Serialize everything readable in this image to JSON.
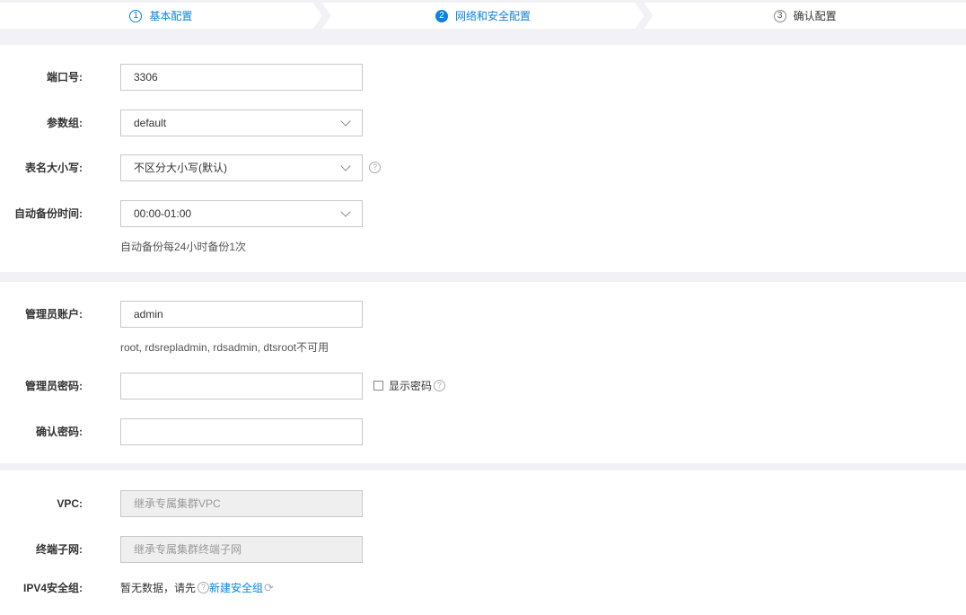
{
  "steps": [
    {
      "num": "1",
      "label": "基本配置"
    },
    {
      "num": "2",
      "label": "网络和安全配置"
    },
    {
      "num": "3",
      "label": "确认配置"
    }
  ],
  "db": {
    "port": {
      "label": "端口号:",
      "value": "3306"
    },
    "param_group": {
      "label": "参数组:",
      "value": "default"
    },
    "table_case": {
      "label": "表名大小写:",
      "value": "不区分大小写(默认)"
    },
    "backup_time": {
      "label": "自动备份时间:",
      "value": "00:00-01:00",
      "hint": "自动备份每24小时备份1次"
    }
  },
  "account": {
    "admin": {
      "label": "管理员账户:",
      "value": "admin",
      "hint": "root, rdsrepladmin, rdsadmin, dtsroot不可用"
    },
    "password": {
      "label": "管理员密码:",
      "value": "",
      "show_label": "显示密码"
    },
    "confirm": {
      "label": "确认密码:",
      "value": ""
    }
  },
  "network": {
    "vpc": {
      "label": "VPC:",
      "value": "继承专属集群VPC"
    },
    "subnet": {
      "label": "终端子网:",
      "value": "继承专属集群终端子网"
    },
    "sg": {
      "label": "IPV4安全组:",
      "text": "暂无数据，请先",
      "link": "新建安全组"
    }
  },
  "colors": {
    "accent": "#0a84e0",
    "bg": "#f2f2f6"
  }
}
